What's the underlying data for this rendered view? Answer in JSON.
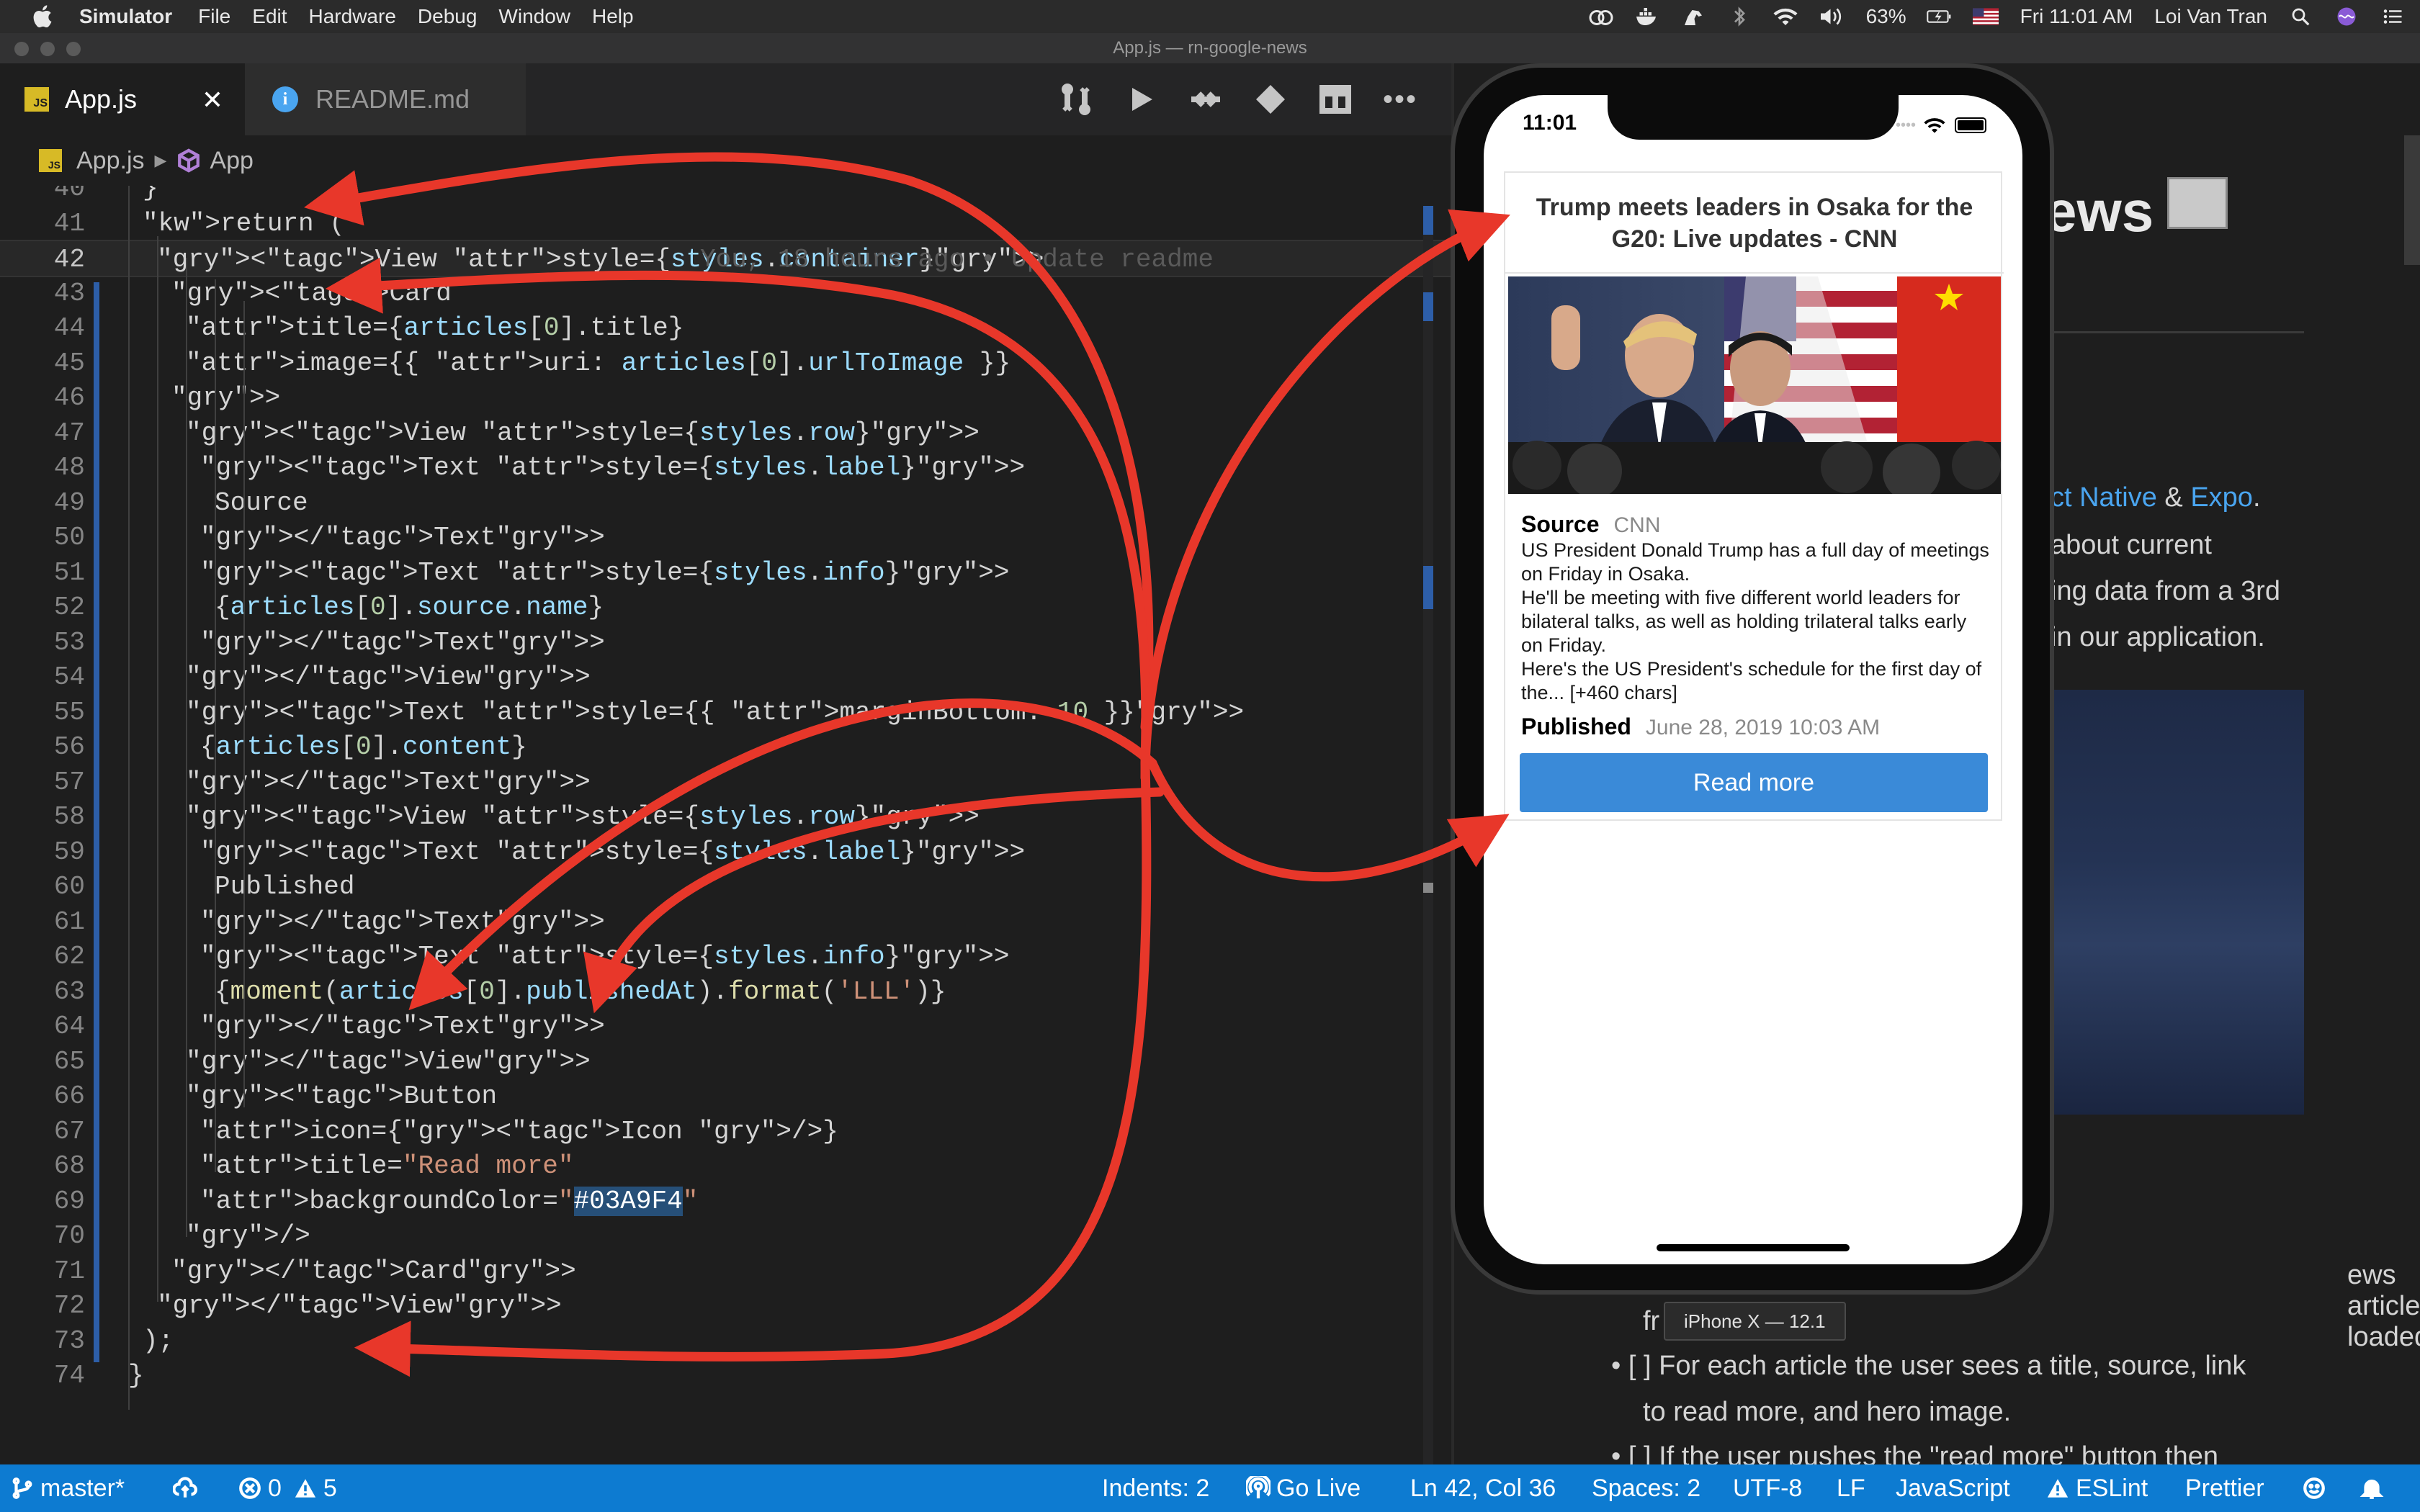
{
  "menubar": {
    "app": "Simulator",
    "items": [
      "File",
      "Edit",
      "Hardware",
      "Debug",
      "Window",
      "Help"
    ],
    "battery": "63%",
    "clock": "Fri 11:01 AM",
    "user": "Loi Van Tran"
  },
  "window": {
    "title": "App.js — rn-google-news"
  },
  "tabs": [
    {
      "label": "App.js",
      "icon": "js-icon",
      "active": true
    },
    {
      "label": "README.md",
      "icon": "info-icon",
      "active": false
    }
  ],
  "breadcrumb": {
    "file": "App.js",
    "symbol": "App"
  },
  "editor": {
    "lines": [
      {
        "n": "40",
        "text": "}"
      },
      {
        "n": "41",
        "text": "return ("
      },
      {
        "n": "42",
        "text": "<View style={styles.container}>"
      },
      {
        "n": "43",
        "text": "<Card"
      },
      {
        "n": "44",
        "text": "title={articles[0].title}"
      },
      {
        "n": "45",
        "text": "image={{ uri: articles[0].urlToImage }}"
      },
      {
        "n": "46",
        "text": ">"
      },
      {
        "n": "47",
        "text": "<View style={styles.row}>"
      },
      {
        "n": "48",
        "text": "<Text style={styles.label}>"
      },
      {
        "n": "49",
        "text": "Source"
      },
      {
        "n": "50",
        "text": "</Text>"
      },
      {
        "n": "51",
        "text": "<Text style={styles.info}>"
      },
      {
        "n": "52",
        "text": "{articles[0].source.name}"
      },
      {
        "n": "53",
        "text": "</Text>"
      },
      {
        "n": "54",
        "text": "</View>"
      },
      {
        "n": "55",
        "text": "<Text style={{ marginBottom: 10 }}>"
      },
      {
        "n": "56",
        "text": "{articles[0].content}"
      },
      {
        "n": "57",
        "text": "</Text>"
      },
      {
        "n": "58",
        "text": "<View style={styles.row}>"
      },
      {
        "n": "59",
        "text": "<Text style={styles.label}>"
      },
      {
        "n": "60",
        "text": "Published"
      },
      {
        "n": "61",
        "text": "</Text>"
      },
      {
        "n": "62",
        "text": "<Text style={styles.info}>"
      },
      {
        "n": "63",
        "text": "{moment(articles[0].publishedAt).format('LLL')}"
      },
      {
        "n": "64",
        "text": "</Text>"
      },
      {
        "n": "65",
        "text": "</View>"
      },
      {
        "n": "66",
        "text": "<Button"
      },
      {
        "n": "67",
        "text": "icon={<Icon />}"
      },
      {
        "n": "68",
        "text": "title=\"Read more\""
      },
      {
        "n": "69",
        "text": "backgroundColor=\"#03A9F4\""
      },
      {
        "n": "70",
        "text": "/>"
      },
      {
        "n": "71",
        "text": "</Card>"
      },
      {
        "n": "72",
        "text": "</View>"
      },
      {
        "n": "73",
        "text": ");"
      },
      {
        "n": "74",
        "text": "}"
      }
    ],
    "blame": "You, 18 hours ago • Update readme",
    "current_line": "42"
  },
  "preview": {
    "heading_fragment": "ews",
    "line1_a": "ct Native",
    "line1_b": "&",
    "line1_c": "Expo",
    "line1_d": ".",
    "line2": "about current",
    "line3": "ing data from a 3rd",
    "line4": "in our application.",
    "bullet1_a": "ews articles loaded",
    "bullet1_b": "fr",
    "bullet2_a": "[ ] For each article the user sees a title, source, link",
    "bullet2_b": "to read more, and hero image.",
    "bullet3": "[ ] If the user pushes the \"read more\" button then"
  },
  "simulator": {
    "time": "11:01",
    "card": {
      "title": "Trump meets leaders in Osaka for the G20: Live updates - CNN",
      "source_label": "Source",
      "source_value": "CNN",
      "content": "US President Donald Trump has a full day of meetings on Friday in Osaka.\nHe'll be meeting with five different world leaders for bilateral talks, as well as holding trilateral talks early on Friday.\nHere's the US President's schedule for the first day of the... [+460 chars]",
      "published_label": "Published",
      "published_value": "June 28, 2019 10:03 AM",
      "button": "Read more",
      "button_color": "#3a8ad8"
    },
    "device_label": "iPhone X — 12.1"
  },
  "statusbar": {
    "branch": "master*",
    "errors": "0",
    "warnings": "5",
    "indents": "Indents: 2",
    "golive": "Go Live",
    "position": "Ln 42, Col 36",
    "spaces": "Spaces: 2",
    "encoding": "UTF-8",
    "eol": "LF",
    "language": "JavaScript",
    "eslint": "ESLint",
    "prettier": "Prettier",
    "color": "#0d7bd1"
  },
  "annotation_color": "#e8372a"
}
